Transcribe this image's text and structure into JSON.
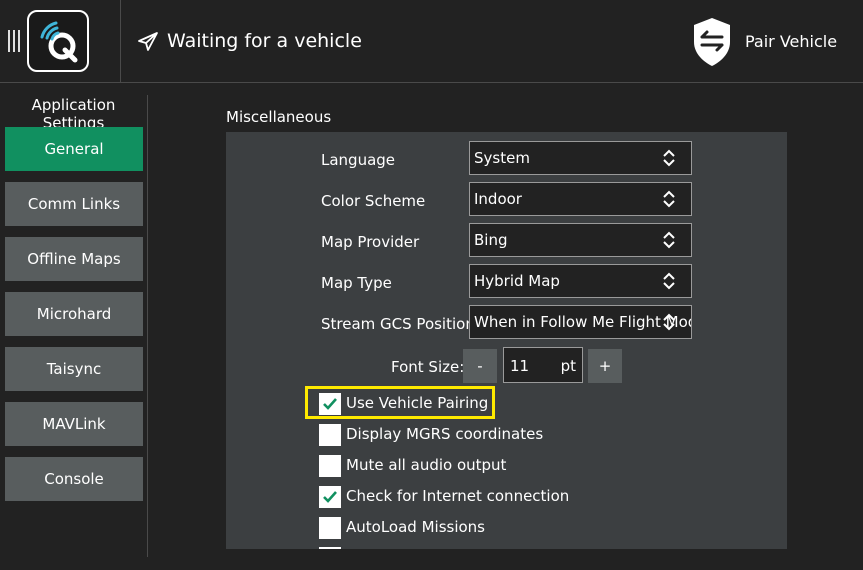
{
  "toolbar": {
    "status_text": "Waiting for a vehicle",
    "pair_label": "Pair Vehicle",
    "icons": [
      "menu-handle-icon",
      "qgc-logo-icon",
      "paper-plane-icon",
      "shield-arrows-icon"
    ]
  },
  "sidebar": {
    "title": "Application Settings",
    "items": [
      {
        "label": "General",
        "active": true
      },
      {
        "label": "Comm Links",
        "active": false
      },
      {
        "label": "Offline Maps",
        "active": false
      },
      {
        "label": "Microhard",
        "active": false
      },
      {
        "label": "Taisync",
        "active": false
      },
      {
        "label": "MAVLink",
        "active": false
      },
      {
        "label": "Console",
        "active": false
      }
    ]
  },
  "main": {
    "section_title": "Miscellaneous",
    "settings": [
      {
        "label": "Language",
        "value": "System"
      },
      {
        "label": "Color Scheme",
        "value": "Indoor"
      },
      {
        "label": "Map Provider",
        "value": "Bing"
      },
      {
        "label": "Map Type",
        "value": "Hybrid Map"
      },
      {
        "label": "Stream GCS Position",
        "value": "When in Follow Me Flight Mode"
      }
    ],
    "font_size": {
      "label": "Font Size:",
      "decrement": "-",
      "value": "11",
      "unit": "pt",
      "increment": "+"
    },
    "checkboxes": [
      {
        "label": "Use Vehicle Pairing",
        "checked": true
      },
      {
        "label": "Display MGRS coordinates",
        "checked": false
      },
      {
        "label": "Mute all audio output",
        "checked": false
      },
      {
        "label": "Check for Internet connection",
        "checked": true
      },
      {
        "label": "AutoLoad Missions",
        "checked": false
      }
    ]
  },
  "colors": {
    "background": "#222222",
    "active_accent": "#119060",
    "button": "#585d5e",
    "panel": "#3c3f41",
    "check_mark": "#119060",
    "highlight": "#ffea00"
  }
}
